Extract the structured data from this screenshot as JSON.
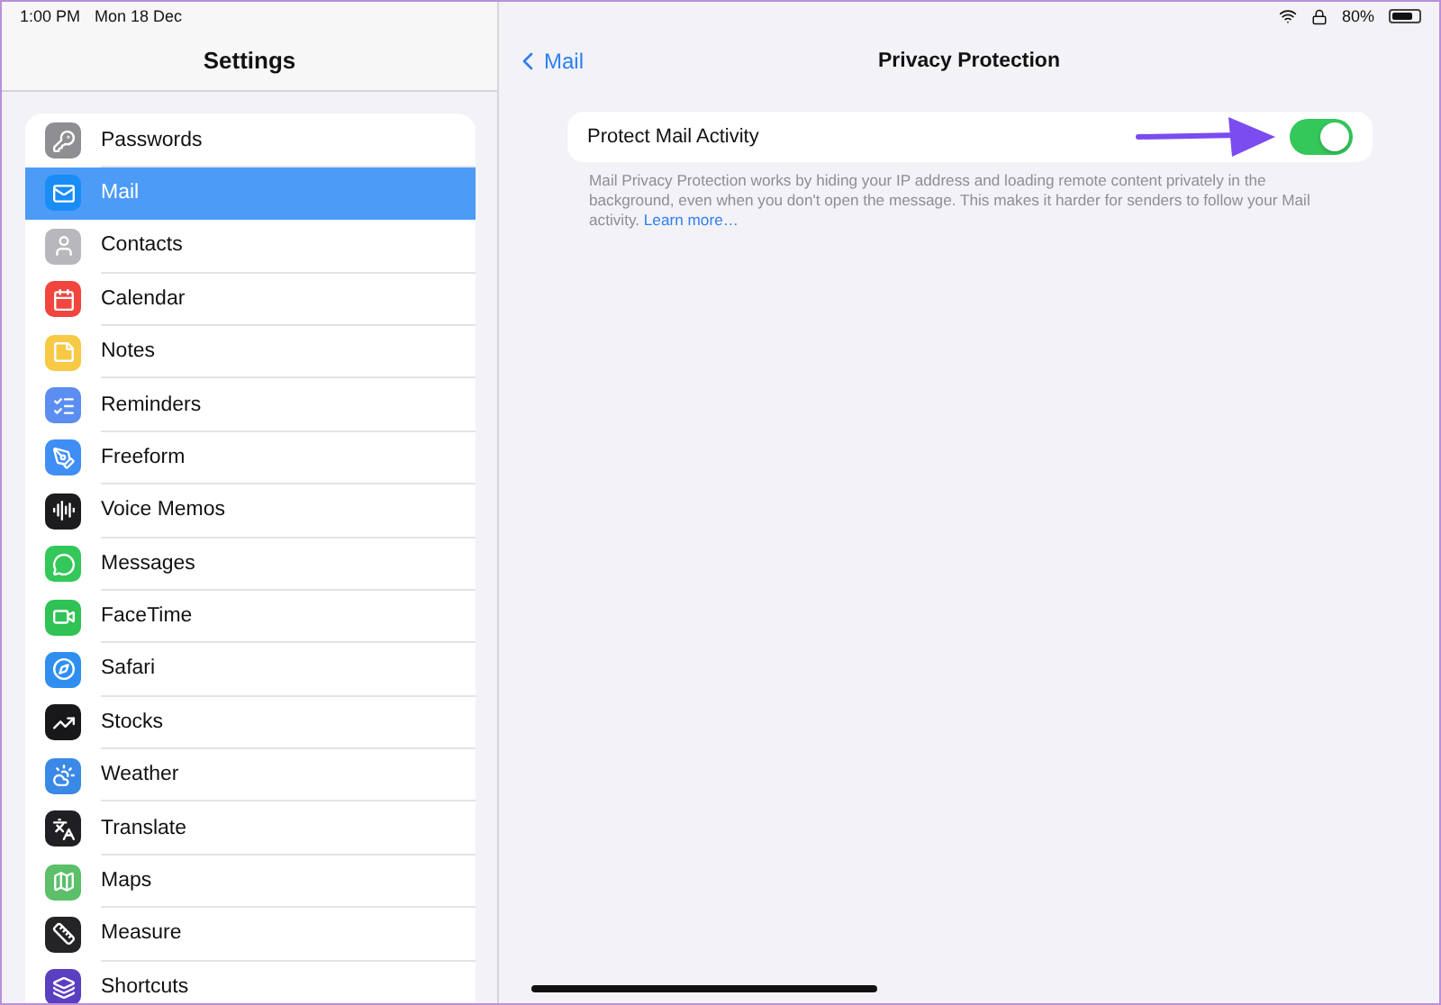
{
  "status_bar": {
    "time": "1:00 PM",
    "date": "Mon 18 Dec",
    "battery": "80%"
  },
  "sidebar": {
    "title": "Settings",
    "items": [
      {
        "label": "Passwords",
        "selected": false,
        "color": "#8e8e93"
      },
      {
        "label": "Mail",
        "selected": true,
        "color": "#1a8cf5"
      },
      {
        "label": "Contacts",
        "selected": false,
        "color": "#b8b8bc"
      },
      {
        "label": "Calendar",
        "selected": false,
        "color": "#f2453d"
      },
      {
        "label": "Notes",
        "selected": false,
        "color": "#f7c944"
      },
      {
        "label": "Reminders",
        "selected": false,
        "color": "#5b8ef0"
      },
      {
        "label": "Freeform",
        "selected": false,
        "color": "#3f8ef5"
      },
      {
        "label": "Voice Memos",
        "selected": false,
        "color": "#1c1c1e"
      },
      {
        "label": "Messages",
        "selected": false,
        "color": "#34c759"
      },
      {
        "label": "FaceTime",
        "selected": false,
        "color": "#30c254"
      },
      {
        "label": "Safari",
        "selected": false,
        "color": "#2f8ff0"
      },
      {
        "label": "Stocks",
        "selected": false,
        "color": "#18181a"
      },
      {
        "label": "Weather",
        "selected": false,
        "color": "#3a89e6"
      },
      {
        "label": "Translate",
        "selected": false,
        "color": "#202024"
      },
      {
        "label": "Maps",
        "selected": false,
        "color": "#5cbf6a"
      },
      {
        "label": "Measure",
        "selected": false,
        "color": "#242426"
      },
      {
        "label": "Shortcuts",
        "selected": false,
        "color": "#5a3fc0"
      }
    ]
  },
  "detail": {
    "back": "Mail",
    "title": "Privacy Protection",
    "setting": {
      "label": "Protect Mail Activity",
      "on": true
    },
    "footer": "Mail Privacy Protection works by hiding your IP address and loading remote content privately in the background, even when you don't open the message. This makes it harder for senders to follow your Mail activity.",
    "link": "Learn more…"
  }
}
